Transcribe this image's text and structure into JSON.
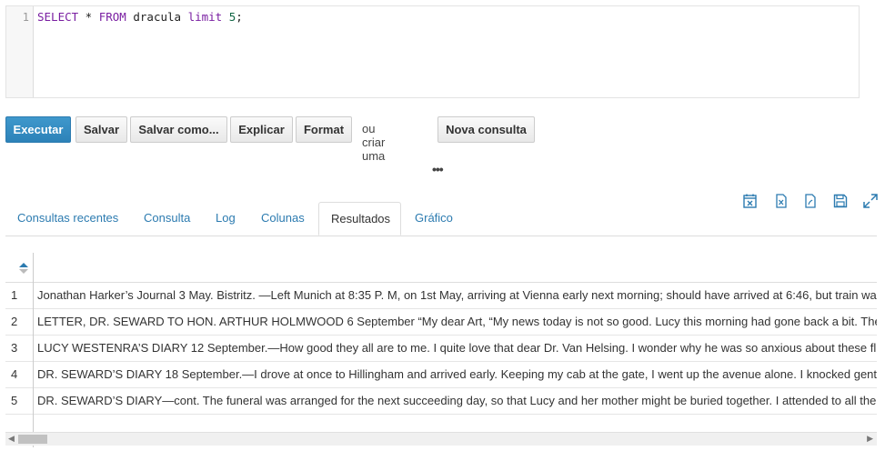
{
  "editor": {
    "line_number": "1",
    "tokens": [
      {
        "text": "SELECT",
        "kind": "kw"
      },
      {
        "text": " * ",
        "kind": "plain"
      },
      {
        "text": "FROM",
        "kind": "kw"
      },
      {
        "text": " dracula ",
        "kind": "plain"
      },
      {
        "text": "limit",
        "kind": "kw"
      },
      {
        "text": " ",
        "kind": "plain"
      },
      {
        "text": "5",
        "kind": "num"
      },
      {
        "text": ";",
        "kind": "plain"
      }
    ]
  },
  "toolbar": {
    "execute": "Executar",
    "save": "Salvar",
    "save_as": "Salvar como...",
    "explain": "Explicar",
    "format": "Format",
    "or_create": "ou criar uma",
    "new_query": "Nova consulta"
  },
  "splitter": "•••",
  "icons": [
    "calendar-export-icon",
    "excel-export-icon",
    "pdf-export-icon",
    "save-icon",
    "expand-icon"
  ],
  "tabs": [
    {
      "label": "Consultas recentes",
      "active": false
    },
    {
      "label": "Consulta",
      "active": false
    },
    {
      "label": "Log",
      "active": false
    },
    {
      "label": "Colunas",
      "active": false
    },
    {
      "label": "Resultados",
      "active": true
    },
    {
      "label": "Gráfico",
      "active": false
    }
  ],
  "results": {
    "rows": [
      {
        "n": "1",
        "text": "Jonathan Harker’s Journal 3 May. Bistritz. —Left Munich at 8:35 P. M, on 1st May, arriving at Vienna early next morning; should have arrived at 6:46, but train wa"
      },
      {
        "n": "2",
        "text": "LETTER, DR. SEWARD TO HON. ARTHUR HOLMWOOD 6 September “My dear Art, “My news today is not so good. Lucy this morning had gone back a bit. The"
      },
      {
        "n": "3",
        "text": "LUCY WESTENRA’S DIARY 12 September.—How good they all are to me. I quite love that dear Dr. Van Helsing. I wonder why he was so anxious about these fl"
      },
      {
        "n": "4",
        "text": "DR. SEWARD’S DIARY 18 September.—I drove at once to Hillingham and arrived early. Keeping my cab at the gate, I went up the avenue alone. I knocked gent"
      },
      {
        "n": "5",
        "text": "DR. SEWARD’S DIARY—cont. The funeral was arranged for the next succeeding day, so that Lucy and her mother might be buried together. I attended to all the"
      }
    ]
  },
  "colors": {
    "accent": "#2c7bb0",
    "keyword": "#7a1fa2",
    "number": "#116644"
  }
}
